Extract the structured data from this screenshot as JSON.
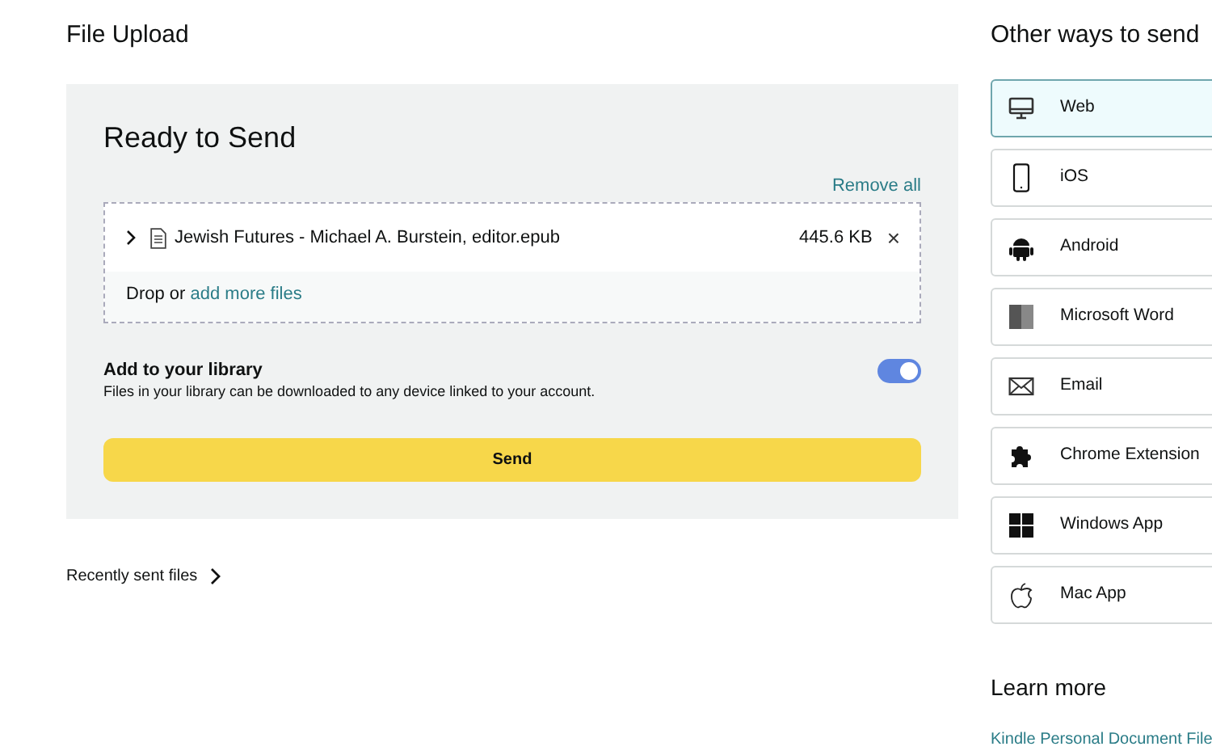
{
  "page_title": "File Upload",
  "panel": {
    "title": "Ready to Send",
    "remove_all": "Remove all",
    "files": [
      {
        "expanded": false,
        "name": "Jewish Futures - Michael A. Burstein, editor.epub",
        "size": "445.6 KB",
        "remove": "×"
      }
    ],
    "drop_text": "Drop or",
    "drop_link": "add more files",
    "library": {
      "label": "Add to your library",
      "description": "Files in your library can be downloaded to any device linked to your account.",
      "on": true
    },
    "send_button": "Send"
  },
  "recently_sent": "Recently sent files",
  "sidebar": {
    "title": "Other ways to send",
    "options": [
      {
        "kind": "web",
        "label": "Web",
        "selected": true
      },
      {
        "kind": "ios",
        "label": "iOS",
        "selected": false
      },
      {
        "kind": "android",
        "label": "Android",
        "selected": false
      },
      {
        "kind": "word",
        "label": "Microsoft Word",
        "selected": false
      },
      {
        "kind": "email",
        "label": "Email",
        "selected": false
      },
      {
        "kind": "chrome",
        "label": "Chrome Extension",
        "selected": false
      },
      {
        "kind": "windows",
        "label": "Windows App",
        "selected": false
      },
      {
        "kind": "mac",
        "label": "Mac App",
        "selected": false
      }
    ],
    "learn_more_title": "Learn more",
    "learn_more_link": "Kindle Personal Document File"
  }
}
